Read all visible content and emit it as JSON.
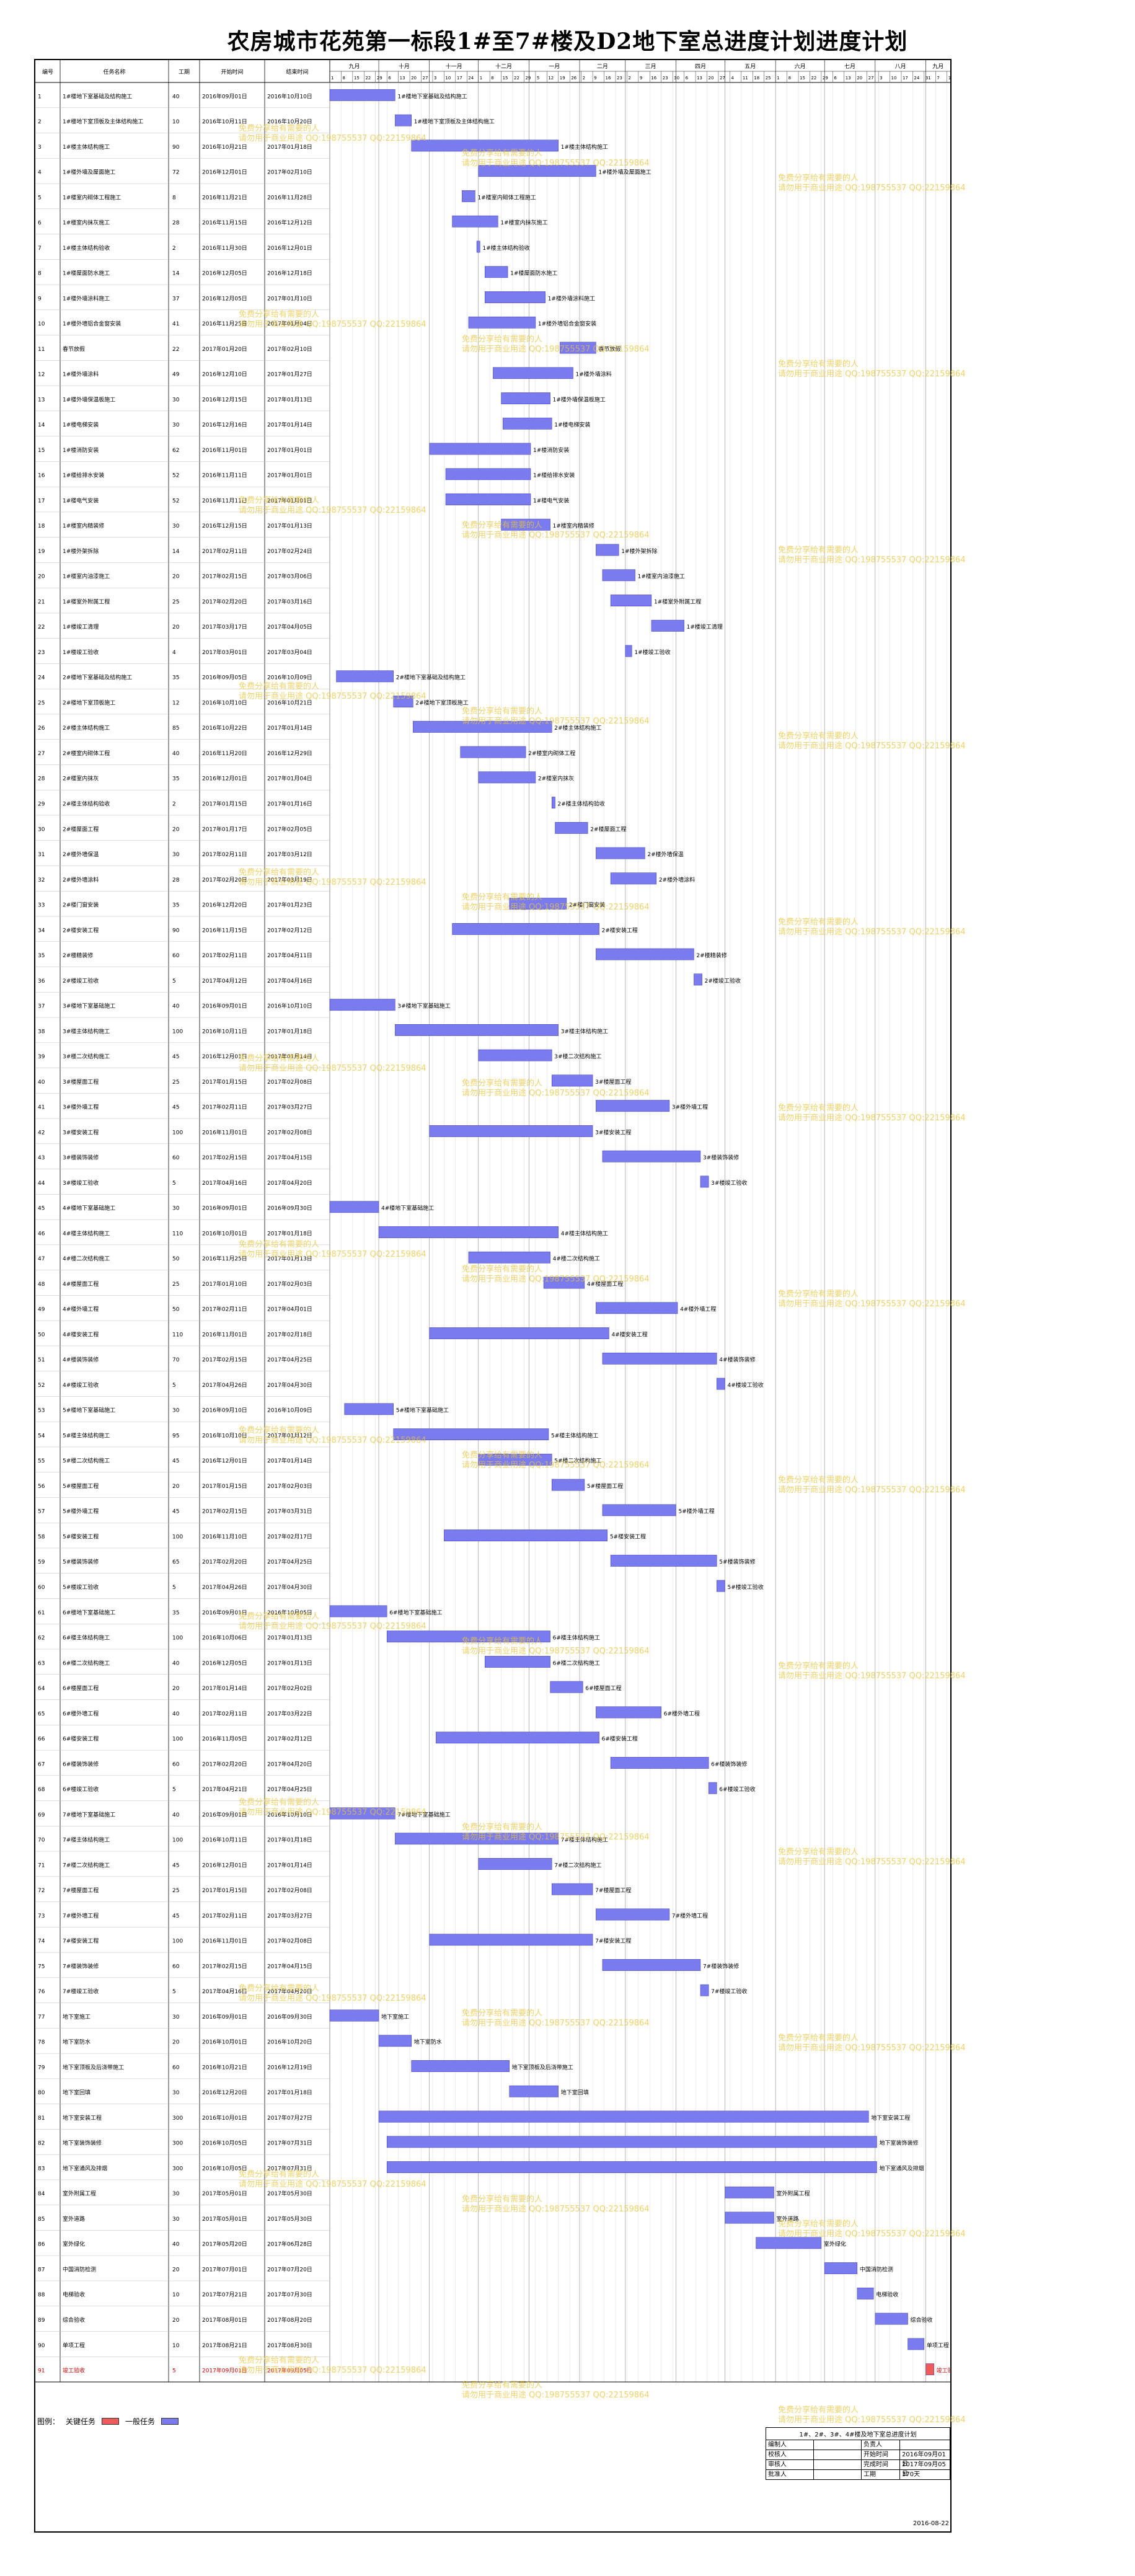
{
  "title": "农房城市花苑第一标段1#至7#楼及D2地下室总进度计划进度计划",
  "header": {
    "id": "编号",
    "name": "任务名称",
    "dur": "工期",
    "start": "开始时间",
    "finish": "结束时间"
  },
  "months": [
    "九月",
    "十月",
    "十一月",
    "十二月",
    "一月",
    "二月",
    "三月",
    "四月",
    "五月",
    "六月",
    "七月",
    "八月",
    "九月"
  ],
  "months_span_days": [
    [
      0,
      30
    ],
    [
      30,
      61
    ],
    [
      61,
      91
    ],
    [
      91,
      122
    ],
    [
      122,
      153
    ],
    [
      153,
      181
    ],
    [
      181,
      212
    ],
    [
      212,
      242
    ],
    [
      242,
      273
    ],
    [
      273,
      303
    ],
    [
      303,
      334
    ],
    [
      334,
      365
    ],
    [
      365,
      380
    ]
  ],
  "day_ticks": [
    "1",
    "8",
    "15",
    "22",
    "29",
    "6",
    "13",
    "20",
    "27",
    "3",
    "10",
    "17",
    "24",
    "1",
    "8",
    "15",
    "22",
    "29",
    "5",
    "12",
    "19",
    "26",
    "2",
    "9",
    "16",
    "23",
    "2",
    "9",
    "16",
    "23",
    "30",
    "6",
    "13",
    "20",
    "27",
    "4",
    "11",
    "18",
    "25",
    "1",
    "8",
    "15",
    "22",
    "29",
    "6",
    "13",
    "20",
    "27",
    "3",
    "10",
    "17",
    "24",
    "31",
    "7",
    "14"
  ],
  "tasks": [
    {
      "id": "1",
      "name": "1#楼地下室基础及结构施工",
      "dur": "40",
      "start": "2016年09月01日",
      "finish": "2016年10月10日",
      "s": 0,
      "d": 40
    },
    {
      "id": "2",
      "name": "1#楼地下室顶板及主体结构施工",
      "dur": "10",
      "start": "2016年10月11日",
      "finish": "2016年10月20日",
      "s": 40,
      "d": 10
    },
    {
      "id": "3",
      "name": "1#楼主体结构施工",
      "dur": "90",
      "start": "2016年10月21日",
      "finish": "2017年01月18日",
      "s": 50,
      "d": 90
    },
    {
      "id": "4",
      "name": "1#楼外墙及屋面施工",
      "dur": "72",
      "start": "2016年12月01日",
      "finish": "2017年02月10日",
      "s": 91,
      "d": 72
    },
    {
      "id": "5",
      "name": "1#楼室内砌体工程施工",
      "dur": "8",
      "start": "2016年11月21日",
      "finish": "2016年11月28日",
      "s": 81,
      "d": 8
    },
    {
      "id": "6",
      "name": "1#楼室内抹灰施工",
      "dur": "28",
      "start": "2016年11月15日",
      "finish": "2016年12月12日",
      "s": 75,
      "d": 28
    },
    {
      "id": "7",
      "name": "1#楼主体结构验收",
      "dur": "2",
      "start": "2016年11月30日",
      "finish": "2016年12月01日",
      "s": 90,
      "d": 2
    },
    {
      "id": "8",
      "name": "1#楼屋面防水施工",
      "dur": "14",
      "start": "2016年12月05日",
      "finish": "2016年12月18日",
      "s": 95,
      "d": 14
    },
    {
      "id": "9",
      "name": "1#楼外墙涂料施工",
      "dur": "37",
      "start": "2016年12月05日",
      "finish": "2017年01月10日",
      "s": 95,
      "d": 37
    },
    {
      "id": "10",
      "name": "1#楼外墙铝合金窗安装",
      "dur": "41",
      "start": "2016年11月25日",
      "finish": "2017年01月04日",
      "s": 85,
      "d": 41
    },
    {
      "id": "11",
      "name": "春节放假",
      "dur": "22",
      "start": "2017年01月20日",
      "finish": "2017年02月10日",
      "s": 141,
      "d": 22
    },
    {
      "id": "12",
      "name": "1#楼外墙涂料",
      "dur": "49",
      "start": "2016年12月10日",
      "finish": "2017年01月27日",
      "s": 100,
      "d": 49
    },
    {
      "id": "13",
      "name": "1#楼外墙保温板施工",
      "dur": "30",
      "start": "2016年12月15日",
      "finish": "2017年01月13日",
      "s": 105,
      "d": 30
    },
    {
      "id": "14",
      "name": "1#楼电梯安装",
      "dur": "30",
      "start": "2016年12月16日",
      "finish": "2017年01月14日",
      "s": 106,
      "d": 30
    },
    {
      "id": "15",
      "name": "1#楼消防安装",
      "dur": "62",
      "start": "2016年11月01日",
      "finish": "2017年01月01日",
      "s": 61,
      "d": 62
    },
    {
      "id": "16",
      "name": "1#楼给排水安装",
      "dur": "52",
      "start": "2016年11月11日",
      "finish": "2017年01月01日",
      "s": 71,
      "d": 52
    },
    {
      "id": "17",
      "name": "1#楼电气安装",
      "dur": "52",
      "start": "2016年11月11日",
      "finish": "2017年01月01日",
      "s": 71,
      "d": 52
    },
    {
      "id": "18",
      "name": "1#楼室内精装修",
      "dur": "30",
      "start": "2016年12月15日",
      "finish": "2017年01月13日",
      "s": 105,
      "d": 30
    },
    {
      "id": "19",
      "name": "1#楼外架拆除",
      "dur": "14",
      "start": "2017年02月11日",
      "finish": "2017年02月24日",
      "s": 163,
      "d": 14
    },
    {
      "id": "20",
      "name": "1#楼室内油漆施工",
      "dur": "20",
      "start": "2017年02月15日",
      "finish": "2017年03月06日",
      "s": 167,
      "d": 20
    },
    {
      "id": "21",
      "name": "1#楼室外附属工程",
      "dur": "25",
      "start": "2017年02月20日",
      "finish": "2017年03月16日",
      "s": 172,
      "d": 25
    },
    {
      "id": "22",
      "name": "1#楼竣工清理",
      "dur": "20",
      "start": "2017年03月17日",
      "finish": "2017年04月05日",
      "s": 197,
      "d": 20
    },
    {
      "id": "23",
      "name": "1#楼竣工验收",
      "dur": "4",
      "start": "2017年03月01日",
      "finish": "2017年03月04日",
      "s": 181,
      "d": 4
    },
    {
      "id": "24",
      "name": "2#楼地下室基础及结构施工",
      "dur": "35",
      "start": "2016年09月05日",
      "finish": "2016年10月09日",
      "s": 4,
      "d": 35
    },
    {
      "id": "25",
      "name": "2#楼地下室顶板施工",
      "dur": "12",
      "start": "2016年10月10日",
      "finish": "2016年10月21日",
      "s": 39,
      "d": 12
    },
    {
      "id": "26",
      "name": "2#楼主体结构施工",
      "dur": "85",
      "start": "2016年10月22日",
      "finish": "2017年01月14日",
      "s": 51,
      "d": 85
    },
    {
      "id": "27",
      "name": "2#楼室内砌体工程",
      "dur": "40",
      "start": "2016年11月20日",
      "finish": "2016年12月29日",
      "s": 80,
      "d": 40
    },
    {
      "id": "28",
      "name": "2#楼室内抹灰",
      "dur": "35",
      "start": "2016年12月01日",
      "finish": "2017年01月04日",
      "s": 91,
      "d": 35
    },
    {
      "id": "29",
      "name": "2#楼主体结构验收",
      "dur": "2",
      "start": "2017年01月15日",
      "finish": "2017年01月16日",
      "s": 136,
      "d": 2
    },
    {
      "id": "30",
      "name": "2#楼屋面工程",
      "dur": "20",
      "start": "2017年01月17日",
      "finish": "2017年02月05日",
      "s": 138,
      "d": 20
    },
    {
      "id": "31",
      "name": "2#楼外墙保温",
      "dur": "30",
      "start": "2017年02月11日",
      "finish": "2017年03月12日",
      "s": 163,
      "d": 30
    },
    {
      "id": "32",
      "name": "2#楼外墙涂料",
      "dur": "28",
      "start": "2017年02月20日",
      "finish": "2017年03月19日",
      "s": 172,
      "d": 28
    },
    {
      "id": "33",
      "name": "2#楼门窗安装",
      "dur": "35",
      "start": "2016年12月20日",
      "finish": "2017年01月23日",
      "s": 110,
      "d": 35
    },
    {
      "id": "34",
      "name": "2#楼安装工程",
      "dur": "90",
      "start": "2016年11月15日",
      "finish": "2017年02月12日",
      "s": 75,
      "d": 90
    },
    {
      "id": "35",
      "name": "2#楼精装修",
      "dur": "60",
      "start": "2017年02月11日",
      "finish": "2017年04月11日",
      "s": 163,
      "d": 60
    },
    {
      "id": "36",
      "name": "2#楼竣工验收",
      "dur": "5",
      "start": "2017年04月12日",
      "finish": "2017年04月16日",
      "s": 223,
      "d": 5
    },
    {
      "id": "37",
      "name": "3#楼地下室基础施工",
      "dur": "40",
      "start": "2016年09月01日",
      "finish": "2016年10月10日",
      "s": 0,
      "d": 40
    },
    {
      "id": "38",
      "name": "3#楼主体结构施工",
      "dur": "100",
      "start": "2016年10月11日",
      "finish": "2017年01月18日",
      "s": 40,
      "d": 100
    },
    {
      "id": "39",
      "name": "3#楼二次结构施工",
      "dur": "45",
      "start": "2016年12月01日",
      "finish": "2017年01月14日",
      "s": 91,
      "d": 45
    },
    {
      "id": "40",
      "name": "3#楼屋面工程",
      "dur": "25",
      "start": "2017年01月15日",
      "finish": "2017年02月08日",
      "s": 136,
      "d": 25
    },
    {
      "id": "41",
      "name": "3#楼外墙工程",
      "dur": "45",
      "start": "2017年02月11日",
      "finish": "2017年03月27日",
      "s": 163,
      "d": 45
    },
    {
      "id": "42",
      "name": "3#楼安装工程",
      "dur": "100",
      "start": "2016年11月01日",
      "finish": "2017年02月08日",
      "s": 61,
      "d": 100
    },
    {
      "id": "43",
      "name": "3#楼装饰装修",
      "dur": "60",
      "start": "2017年02月15日",
      "finish": "2017年04月15日",
      "s": 167,
      "d": 60
    },
    {
      "id": "44",
      "name": "3#楼竣工验收",
      "dur": "5",
      "start": "2017年04月16日",
      "finish": "2017年04月20日",
      "s": 227,
      "d": 5
    },
    {
      "id": "45",
      "name": "4#楼地下室基础施工",
      "dur": "30",
      "start": "2016年09月01日",
      "finish": "2016年09月30日",
      "s": 0,
      "d": 30
    },
    {
      "id": "46",
      "name": "4#楼主体结构施工",
      "dur": "110",
      "start": "2016年10月01日",
      "finish": "2017年01月18日",
      "s": 30,
      "d": 110
    },
    {
      "id": "47",
      "name": "4#楼二次结构施工",
      "dur": "50",
      "start": "2016年11月25日",
      "finish": "2017年01月13日",
      "s": 85,
      "d": 50
    },
    {
      "id": "48",
      "name": "4#楼屋面工程",
      "dur": "25",
      "start": "2017年01月10日",
      "finish": "2017年02月03日",
      "s": 131,
      "d": 25
    },
    {
      "id": "49",
      "name": "4#楼外墙工程",
      "dur": "50",
      "start": "2017年02月11日",
      "finish": "2017年04月01日",
      "s": 163,
      "d": 50
    },
    {
      "id": "50",
      "name": "4#楼安装工程",
      "dur": "110",
      "start": "2016年11月01日",
      "finish": "2017年02月18日",
      "s": 61,
      "d": 110
    },
    {
      "id": "51",
      "name": "4#楼装饰装修",
      "dur": "70",
      "start": "2017年02月15日",
      "finish": "2017年04月25日",
      "s": 167,
      "d": 70
    },
    {
      "id": "52",
      "name": "4#楼竣工验收",
      "dur": "5",
      "start": "2017年04月26日",
      "finish": "2017年04月30日",
      "s": 237,
      "d": 5
    },
    {
      "id": "53",
      "name": "5#楼地下室基础施工",
      "dur": "30",
      "start": "2016年09月10日",
      "finish": "2016年10月09日",
      "s": 9,
      "d": 30
    },
    {
      "id": "54",
      "name": "5#楼主体结构施工",
      "dur": "95",
      "start": "2016年10月10日",
      "finish": "2017年01月12日",
      "s": 39,
      "d": 95
    },
    {
      "id": "55",
      "name": "5#楼二次结构施工",
      "dur": "45",
      "start": "2016年12月01日",
      "finish": "2017年01月14日",
      "s": 91,
      "d": 45
    },
    {
      "id": "56",
      "name": "5#楼屋面工程",
      "dur": "20",
      "start": "2017年01月15日",
      "finish": "2017年02月03日",
      "s": 136,
      "d": 20
    },
    {
      "id": "57",
      "name": "5#楼外墙工程",
      "dur": "45",
      "start": "2017年02月15日",
      "finish": "2017年03月31日",
      "s": 167,
      "d": 45
    },
    {
      "id": "58",
      "name": "5#楼安装工程",
      "dur": "100",
      "start": "2016年11月10日",
      "finish": "2017年02月17日",
      "s": 70,
      "d": 100
    },
    {
      "id": "59",
      "name": "5#楼装饰装修",
      "dur": "65",
      "start": "2017年02月20日",
      "finish": "2017年04月25日",
      "s": 172,
      "d": 65
    },
    {
      "id": "60",
      "name": "5#楼竣工验收",
      "dur": "5",
      "start": "2017年04月26日",
      "finish": "2017年04月30日",
      "s": 237,
      "d": 5
    },
    {
      "id": "61",
      "name": "6#楼地下室基础施工",
      "dur": "35",
      "start": "2016年09月01日",
      "finish": "2016年10月05日",
      "s": 0,
      "d": 35
    },
    {
      "id": "62",
      "name": "6#楼主体结构施工",
      "dur": "100",
      "start": "2016年10月06日",
      "finish": "2017年01月13日",
      "s": 35,
      "d": 100
    },
    {
      "id": "63",
      "name": "6#楼二次结构施工",
      "dur": "40",
      "start": "2016年12月05日",
      "finish": "2017年01月13日",
      "s": 95,
      "d": 40
    },
    {
      "id": "64",
      "name": "6#楼屋面工程",
      "dur": "20",
      "start": "2017年01月14日",
      "finish": "2017年02月02日",
      "s": 135,
      "d": 20
    },
    {
      "id": "65",
      "name": "6#楼外墙工程",
      "dur": "40",
      "start": "2017年02月11日",
      "finish": "2017年03月22日",
      "s": 163,
      "d": 40
    },
    {
      "id": "66",
      "name": "6#楼安装工程",
      "dur": "100",
      "start": "2016年11月05日",
      "finish": "2017年02月12日",
      "s": 65,
      "d": 100
    },
    {
      "id": "67",
      "name": "6#楼装饰装修",
      "dur": "60",
      "start": "2017年02月20日",
      "finish": "2017年04月20日",
      "s": 172,
      "d": 60
    },
    {
      "id": "68",
      "name": "6#楼竣工验收",
      "dur": "5",
      "start": "2017年04月21日",
      "finish": "2017年04月25日",
      "s": 232,
      "d": 5
    },
    {
      "id": "69",
      "name": "7#楼地下室基础施工",
      "dur": "40",
      "start": "2016年09月01日",
      "finish": "2016年10月10日",
      "s": 0,
      "d": 40
    },
    {
      "id": "70",
      "name": "7#楼主体结构施工",
      "dur": "100",
      "start": "2016年10月11日",
      "finish": "2017年01月18日",
      "s": 40,
      "d": 100
    },
    {
      "id": "71",
      "name": "7#楼二次结构施工",
      "dur": "45",
      "start": "2016年12月01日",
      "finish": "2017年01月14日",
      "s": 91,
      "d": 45
    },
    {
      "id": "72",
      "name": "7#楼屋面工程",
      "dur": "25",
      "start": "2017年01月15日",
      "finish": "2017年02月08日",
      "s": 136,
      "d": 25
    },
    {
      "id": "73",
      "name": "7#楼外墙工程",
      "dur": "45",
      "start": "2017年02月11日",
      "finish": "2017年03月27日",
      "s": 163,
      "d": 45
    },
    {
      "id": "74",
      "name": "7#楼安装工程",
      "dur": "100",
      "start": "2016年11月01日",
      "finish": "2017年02月08日",
      "s": 61,
      "d": 100
    },
    {
      "id": "75",
      "name": "7#楼装饰装修",
      "dur": "60",
      "start": "2017年02月15日",
      "finish": "2017年04月15日",
      "s": 167,
      "d": 60
    },
    {
      "id": "76",
      "name": "7#楼竣工验收",
      "dur": "5",
      "start": "2017年04月16日",
      "finish": "2017年04月20日",
      "s": 227,
      "d": 5
    },
    {
      "id": "77",
      "name": "地下室施工",
      "dur": "30",
      "start": "2016年09月01日",
      "finish": "2016年09月30日",
      "s": 0,
      "d": 30
    },
    {
      "id": "78",
      "name": "地下室防水",
      "dur": "20",
      "start": "2016年10月01日",
      "finish": "2016年10月20日",
      "s": 30,
      "d": 20
    },
    {
      "id": "79",
      "name": "地下室顶板及后浇带施工",
      "dur": "60",
      "start": "2016年10月21日",
      "finish": "2016年12月19日",
      "s": 50,
      "d": 60
    },
    {
      "id": "80",
      "name": "地下室回填",
      "dur": "30",
      "start": "2016年12月20日",
      "finish": "2017年01月18日",
      "s": 110,
      "d": 30
    },
    {
      "id": "81",
      "name": "地下室安装工程",
      "dur": "300",
      "start": "2016年10月01日",
      "finish": "2017年07月27日",
      "s": 30,
      "d": 300
    },
    {
      "id": "82",
      "name": "地下室装饰装修",
      "dur": "300",
      "start": "2016年10月05日",
      "finish": "2017年07月31日",
      "s": 35,
      "d": 300
    },
    {
      "id": "83",
      "name": "地下室通风及排烟",
      "dur": "300",
      "start": "2016年10月05日",
      "finish": "2017年07月31日",
      "s": 35,
      "d": 300
    },
    {
      "id": "84",
      "name": "室外附属工程",
      "dur": "30",
      "start": "2017年05月01日",
      "finish": "2017年05月30日",
      "s": 242,
      "d": 30
    },
    {
      "id": "85",
      "name": "室外道路",
      "dur": "30",
      "start": "2017年05月01日",
      "finish": "2017年05月30日",
      "s": 242,
      "d": 30
    },
    {
      "id": "86",
      "name": "室外绿化",
      "dur": "40",
      "start": "2017年05月20日",
      "finish": "2017年06月28日",
      "s": 261,
      "d": 40
    },
    {
      "id": "87",
      "name": "中国消防检测",
      "dur": "20",
      "start": "2017年07月01日",
      "finish": "2017年07月20日",
      "s": 303,
      "d": 20
    },
    {
      "id": "88",
      "name": "电梯验收",
      "dur": "10",
      "start": "2017年07月21日",
      "finish": "2017年07月30日",
      "s": 323,
      "d": 10
    },
    {
      "id": "89",
      "name": "综合验收",
      "dur": "20",
      "start": "2017年08月01日",
      "finish": "2017年08月20日",
      "s": 334,
      "d": 20
    },
    {
      "id": "90",
      "name": "单项工程",
      "dur": "10",
      "start": "2017年08月21日",
      "finish": "2017年08月30日",
      "s": 354,
      "d": 10
    },
    {
      "id": "91",
      "name": "竣工验收",
      "dur": "5",
      "start": "2017年09月01日",
      "finish": "2017年09月05日",
      "s": 365,
      "d": 5,
      "crit": true
    }
  ],
  "watermark": "免费分享给有需要的人\n请勿用于商业用途 QQ:198755537 QQ:22159864",
  "legend": {
    "label": "图例：",
    "critical": "关键任务",
    "normal": "一般任务"
  },
  "info": {
    "caption": "1#、2#、3#、4#楼及地下室总进度计划",
    "rows": [
      [
        "编制人",
        "",
        "负责人",
        ""
      ],
      [
        "校核人",
        "",
        "开始时间",
        "2016年09月01日"
      ],
      [
        "审核人",
        "",
        "完成时间",
        "2017年09月05日"
      ],
      [
        "批准人",
        "",
        "工期",
        "370天"
      ]
    ],
    "date": "2016-08-22"
  },
  "colors": {
    "bar": "#7b7bf0",
    "bar_stroke": "#3a3ab0",
    "crit": "#ef5b5b",
    "grid": "#bdbdbd",
    "weekend_line": "#d8d8d8"
  }
}
